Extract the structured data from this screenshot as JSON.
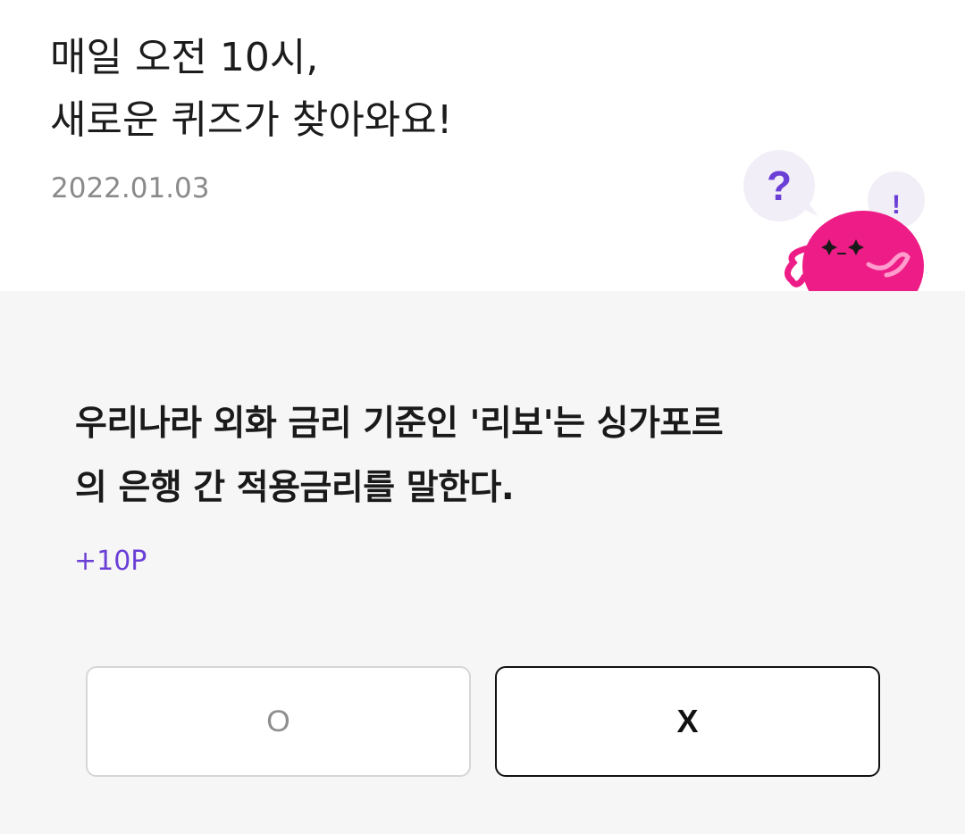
{
  "header": {
    "headline_line1": "매일 오전 10시,",
    "headline_line2": "새로운 퀴즈가 찾아와요!",
    "date": "2022.01.03"
  },
  "mascot": {
    "question_mark": "?",
    "exclamation_mark": "!",
    "body_color": "#ee1c86",
    "bubble_color": "#f1eef7",
    "accent_color": "#6b3fd6"
  },
  "quiz": {
    "question_line1": "우리나라 외화 금리 기준인 '리보'는 싱가포르",
    "question_line2": "의 은행 간 적용금리를 말한다.",
    "points": "+10P",
    "answer_o": "O",
    "answer_x": "X"
  }
}
